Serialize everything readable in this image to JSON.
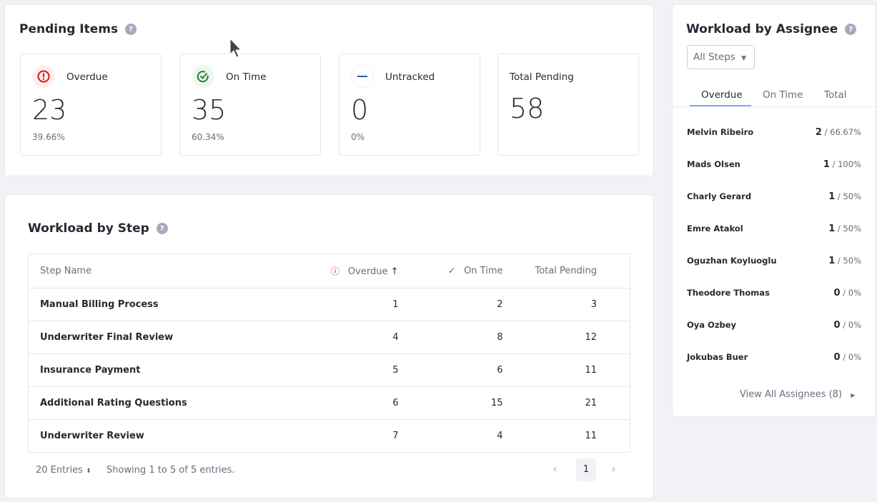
{
  "pending": {
    "title": "Pending Items",
    "help": "?",
    "stats": [
      {
        "label": "Overdue",
        "value": "23",
        "pct": "39.66%",
        "icon": "exclamation-circle-icon",
        "color": "#da1414"
      },
      {
        "label": "On Time",
        "value": "35",
        "pct": "60.34%",
        "icon": "check-circle-icon",
        "color": "#287d3c"
      },
      {
        "label": "Untracked",
        "value": "0",
        "pct": "0%",
        "icon": "dash-icon",
        "color": "#2e5aac"
      },
      {
        "label": "Total Pending",
        "value": "58"
      }
    ]
  },
  "step": {
    "title": "Workload by Step",
    "help": "?",
    "headers": [
      "Step Name",
      "Overdue",
      "On Time",
      "Total Pending"
    ],
    "sort_icon": "↑",
    "rows": [
      [
        "Manual Billing Process",
        "1",
        "2",
        "3"
      ],
      [
        "Underwriter Final Review",
        "4",
        "8",
        "12"
      ],
      [
        "Insurance Payment",
        "5",
        "6",
        "11"
      ],
      [
        "Additional Rating Questions",
        "6",
        "15",
        "21"
      ],
      [
        "Underwriter Review",
        "7",
        "4",
        "11"
      ]
    ],
    "entries": "20 Entries",
    "showing": "Showing 1 to 5 of 5 entries.",
    "page": "1"
  },
  "assignee": {
    "title": "Workload by Assignee",
    "help": "?",
    "filter": "All Steps",
    "tabs": [
      "Overdue",
      "On Time",
      "Total"
    ],
    "active_tab": "Overdue",
    "rows": [
      [
        "Melvin Ribeiro",
        "2",
        "/ 66.67%"
      ],
      [
        "Mads Olsen",
        "1",
        "/ 100%"
      ],
      [
        "Charly Gerard",
        "1",
        "/ 50%"
      ],
      [
        "Emre Atakol",
        "1",
        "/ 50%"
      ],
      [
        "Oguzhan Koyluoglu",
        "1",
        "/ 50%"
      ],
      [
        "Theodore Thomas",
        "0",
        "/ 0%"
      ],
      [
        "Oya Ozbey",
        "0",
        "/ 0%"
      ],
      [
        "Jokubas Buer",
        "0",
        "/ 0%"
      ]
    ],
    "view_all": "View All Assignees (8)"
  },
  "accent": "#80acff"
}
